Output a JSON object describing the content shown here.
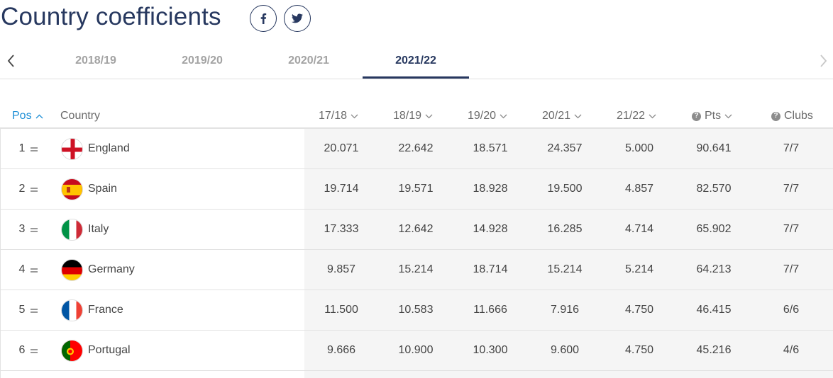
{
  "header": {
    "title": "Country coefficients",
    "social": [
      {
        "name": "facebook-icon",
        "glyph": "f"
      },
      {
        "name": "twitter-icon",
        "glyph": "bird"
      }
    ]
  },
  "seasons": {
    "tabs": [
      {
        "label": "2018/19",
        "active": false
      },
      {
        "label": "2019/20",
        "active": false
      },
      {
        "label": "2020/21",
        "active": false
      },
      {
        "label": "2021/22",
        "active": true
      }
    ]
  },
  "table": {
    "columns": {
      "pos": "Pos",
      "country": "Country",
      "s1718": "17/18",
      "s1819": "18/19",
      "s1920": "19/20",
      "s2021": "20/21",
      "s2122": "21/22",
      "pts": "Pts",
      "clubs": "Clubs"
    },
    "rows": [
      {
        "pos": "1",
        "country": "England",
        "flag": "england",
        "s1718": "20.071",
        "s1819": "22.642",
        "s1920": "18.571",
        "s2021": "24.357",
        "s2122": "5.000",
        "pts": "90.641",
        "clubs": "7/7"
      },
      {
        "pos": "2",
        "country": "Spain",
        "flag": "spain",
        "s1718": "19.714",
        "s1819": "19.571",
        "s1920": "18.928",
        "s2021": "19.500",
        "s2122": "4.857",
        "pts": "82.570",
        "clubs": "7/7"
      },
      {
        "pos": "3",
        "country": "Italy",
        "flag": "italy",
        "s1718": "17.333",
        "s1819": "12.642",
        "s1920": "14.928",
        "s2021": "16.285",
        "s2122": "4.714",
        "pts": "65.902",
        "clubs": "7/7"
      },
      {
        "pos": "4",
        "country": "Germany",
        "flag": "germany",
        "s1718": "9.857",
        "s1819": "15.214",
        "s1920": "18.714",
        "s2021": "15.214",
        "s2122": "5.214",
        "pts": "64.213",
        "clubs": "7/7"
      },
      {
        "pos": "5",
        "country": "France",
        "flag": "france",
        "s1718": "11.500",
        "s1819": "10.583",
        "s1920": "11.666",
        "s2021": "7.916",
        "s2122": "4.750",
        "pts": "46.415",
        "clubs": "6/6"
      },
      {
        "pos": "6",
        "country": "Portugal",
        "flag": "portugal",
        "s1718": "9.666",
        "s1819": "10.900",
        "s1920": "10.300",
        "s2021": "9.600",
        "s2122": "4.750",
        "pts": "45.216",
        "clubs": "4/6"
      }
    ]
  },
  "colors": {
    "brand": "#27385f",
    "active_sort": "#1e8fd6",
    "inactive_tab": "#a3a3a3",
    "shade": "#f5f5f5"
  }
}
